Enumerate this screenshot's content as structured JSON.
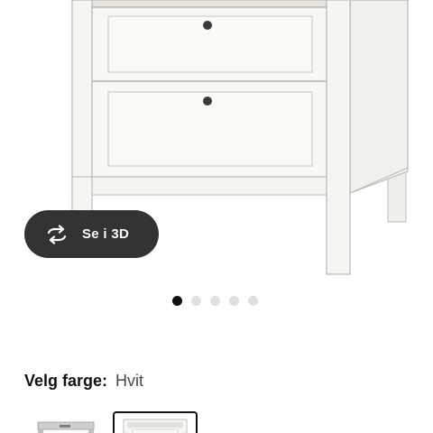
{
  "product_gallery": {
    "view_3d_label": "Se i 3D",
    "slide_count": 5,
    "active_slide": 1
  },
  "color_picker": {
    "title": "Velg farge:",
    "selected_value": "Hvit"
  },
  "colors": {
    "button_bg": "#333333",
    "dot_active": "#111111",
    "dot_inactive": "#dfdfdf",
    "furniture": "#f4f4f0"
  }
}
